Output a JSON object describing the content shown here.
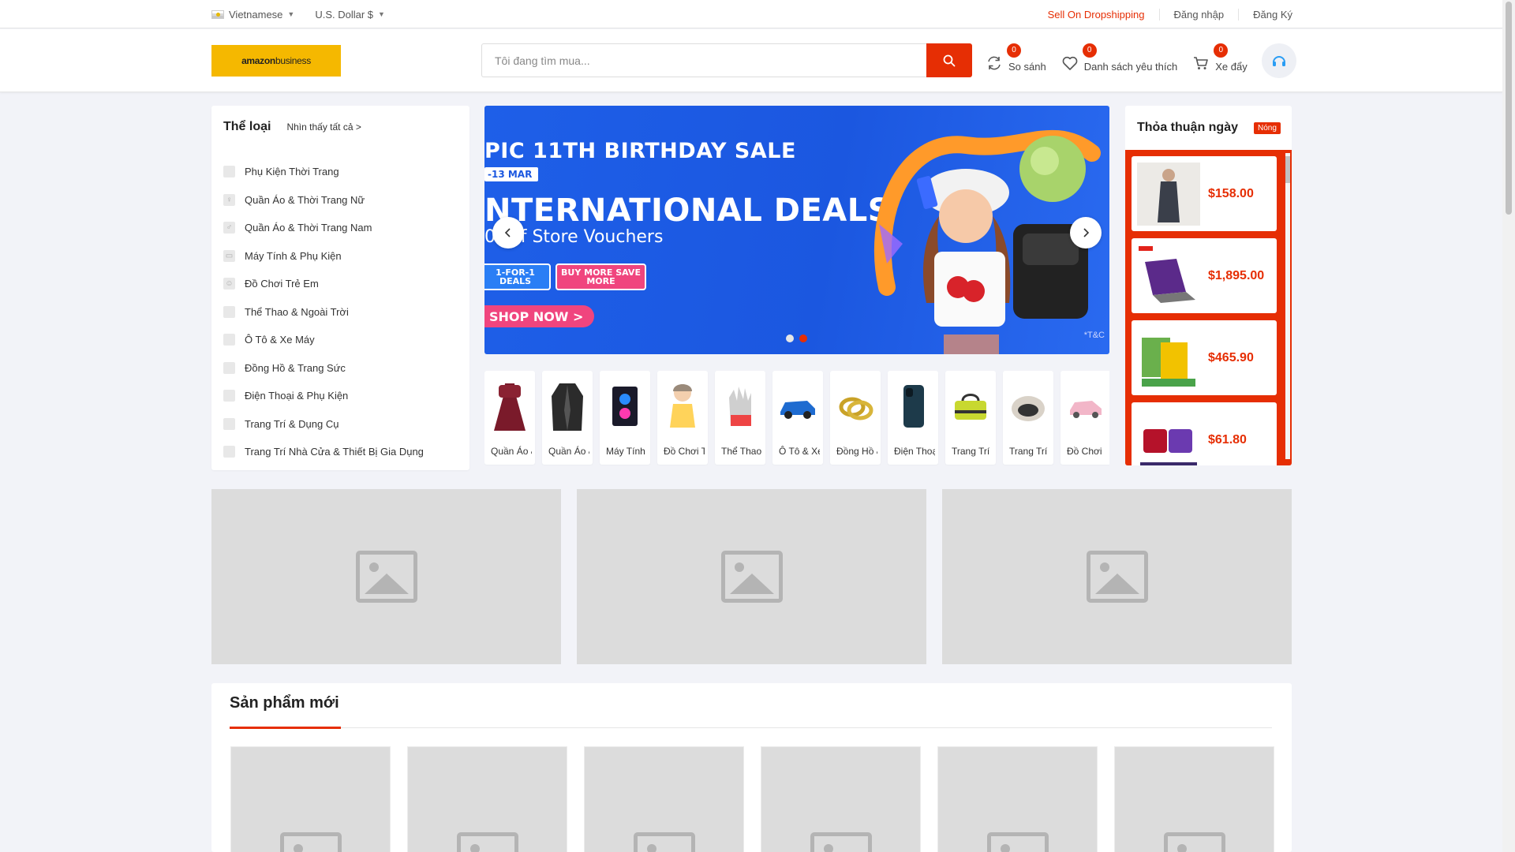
{
  "topbar": {
    "language": "Vietnamese",
    "currency": "U.S. Dollar $",
    "links": [
      "Sell On Dropshipping",
      "Đăng nhập",
      "Đăng Ký"
    ]
  },
  "header": {
    "logo_text": "amazon",
    "logo_sub": "business",
    "search_placeholder": "Tôi đang tìm mua...",
    "compare": {
      "label": "So sánh",
      "count": "0"
    },
    "wishlist": {
      "label": "Danh sách yêu thích",
      "count": "0"
    },
    "cart": {
      "label": "Xe đẩy",
      "count": "0"
    }
  },
  "categories": {
    "title": "Thể loại",
    "see_all": "Nhìn thấy tất cả >",
    "items": [
      "Phụ Kiện Thời Trang",
      "Quần Áo & Thời Trang Nữ",
      "Quần Áo & Thời Trang Nam",
      "Máy Tính & Phụ Kiện",
      "Đồ Chơi Trẻ Em",
      "Thể Thao & Ngoài Trời",
      "Ô Tô & Xe Máy",
      "Đồng Hồ & Trang Sức",
      "Điện Thoại & Phụ Kiện",
      "Trang Trí & Dụng Cụ",
      "Trang Trí Nhà Cửa & Thiết Bị Gia Dụng"
    ]
  },
  "banner": {
    "line1": "PIC 11TH BIRTHDAY SALE",
    "line2": "-13 MAR",
    "line3": "NTERNATIONAL DEALS",
    "line4": "0 Off Store Vouchers",
    "tag1": "1-FOR-1 DEALS",
    "tag2": "BUY MORE SAVE MORE",
    "cta": "SHOP NOW >",
    "tc": "*T&C"
  },
  "category_strip": [
    "Quần Áo & Thời Trang Nữ",
    "Quần Áo & Thời Trang Nam",
    "Máy Tính & Phụ Kiện",
    "Đồ Chơi Trẻ Em",
    "Thể Thao & Ngoài Trời",
    "Ô Tô & Xe Máy",
    "Đồng Hồ & Trang Sức",
    "Điện Thoại & Phụ Kiện",
    "Trang Trí & Dụng Cụ",
    "Trang Trí Nhà Cửa",
    "Đồ Chơi"
  ],
  "deals": {
    "title": "Thỏa thuận ngày",
    "badge": "Nóng",
    "prices": [
      "$158.00",
      "$1,895.00",
      "$465.90",
      "$61.80"
    ]
  },
  "new_products": {
    "title": "Sản phẩm mới"
  },
  "colors": {
    "accent": "#e62e04",
    "banner": "#1b57e0",
    "logo_bg": "#f5b800"
  }
}
